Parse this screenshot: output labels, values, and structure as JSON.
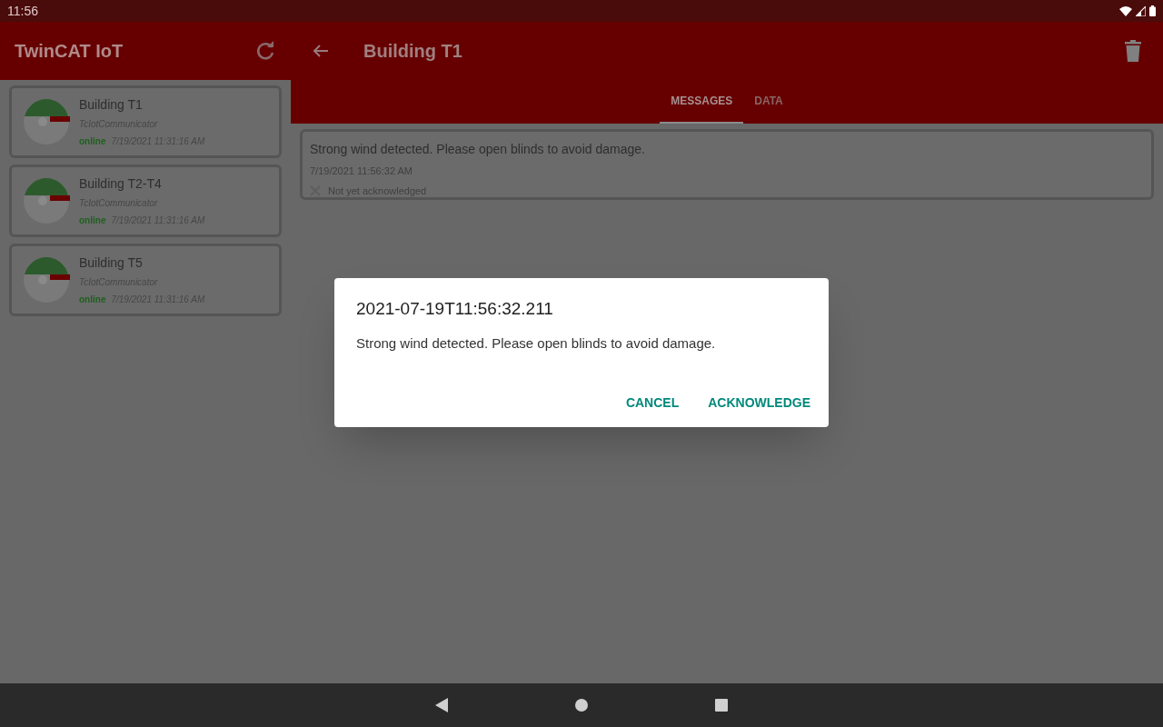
{
  "status_bar": {
    "time": "11:56"
  },
  "sidebar": {
    "title": "TwinCAT IoT",
    "items": [
      {
        "name": "Building T1",
        "subtitle": "TcIotCommunicator",
        "status": "online",
        "timestamp": "7/19/2021 11:31:16 AM"
      },
      {
        "name": "Building T2-T4",
        "subtitle": "TcIotCommunicator",
        "status": "online",
        "timestamp": "7/19/2021 11:31:16 AM"
      },
      {
        "name": "Building T5",
        "subtitle": "TcIotCommunicator",
        "status": "online",
        "timestamp": "7/19/2021 11:31:16 AM"
      }
    ]
  },
  "detail": {
    "title": "Building T1",
    "tabs": [
      {
        "label": "MESSAGES",
        "selected": true
      },
      {
        "label": "DATA",
        "selected": false
      }
    ],
    "messages": [
      {
        "text": "Strong wind detected. Please open blinds to avoid damage.",
        "timestamp": "7/19/2021 11:56:32 AM",
        "ack_status": "Not yet acknowledged",
        "acknowledged": false
      }
    ]
  },
  "dialog": {
    "title": "2021-07-19T11:56:32.211",
    "body": "Strong wind detected. Please open blinds to avoid damage.",
    "buttons": [
      "CANCEL",
      "ACKNOWLEDGE"
    ]
  }
}
